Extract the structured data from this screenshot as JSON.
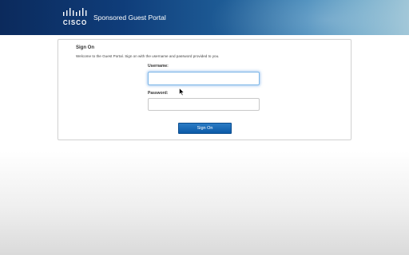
{
  "header": {
    "logo_text": "CISCO",
    "title": "Sponsored Guest Portal"
  },
  "signon": {
    "heading": "Sign On",
    "description": "Welcome to the Guest Portal. Sign on with the username and password provided to you.",
    "username_label": "Username:",
    "username_value": "",
    "password_label": "Password:",
    "password_value": "",
    "button_label": "Sign On"
  },
  "colors": {
    "banner_dark": "#0b2a5c",
    "banner_light": "#9cc4d6",
    "button_blue": "#0b5aa8",
    "focus_blue": "#7fb7e8"
  },
  "icons": {
    "logo": "cisco-logo-icon",
    "pointer": "mouse-pointer-icon"
  }
}
